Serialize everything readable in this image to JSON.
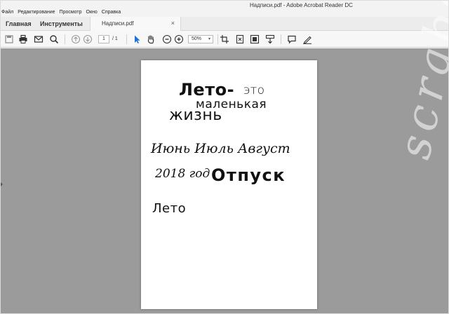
{
  "window": {
    "title": "Надписи.pdf - Adobe Acrobat Reader DC",
    "menu": [
      "Файл",
      "Редактирование",
      "Просмотр",
      "Окно",
      "Справка"
    ]
  },
  "tabs": {
    "home": "Главная",
    "tools": "Инструменты",
    "document": "Надписи.pdf",
    "close": "×"
  },
  "toolbar": {
    "page_current": "1",
    "page_total": "/ 1",
    "zoom": "50%",
    "zoom_arrow": "▾",
    "icons": [
      "save-icon",
      "print-icon",
      "email-icon",
      "search-icon",
      "prev-page-icon",
      "next-page-icon",
      "select-cursor-icon",
      "hand-icon",
      "zoom-out-icon",
      "zoom-in-icon",
      "crop-icon",
      "fit-page-icon",
      "fullscreen-icon",
      "scroll-icon",
      "comment-icon",
      "sign-icon"
    ],
    "accent_color": "#1a73d9"
  },
  "document": {
    "lines": {
      "leto": "Лето-",
      "eto": "это",
      "small": "маленькая",
      "life": "жизнь",
      "months": "Июнь Июль Август",
      "year": "2018 год",
      "vacation": "Отпуск",
      "summer": "Лето"
    }
  },
  "watermark": {
    "text": "scrabo"
  },
  "colors": {
    "viewer_bg": "#9b9b9b",
    "page_bg": "#ffffff"
  }
}
